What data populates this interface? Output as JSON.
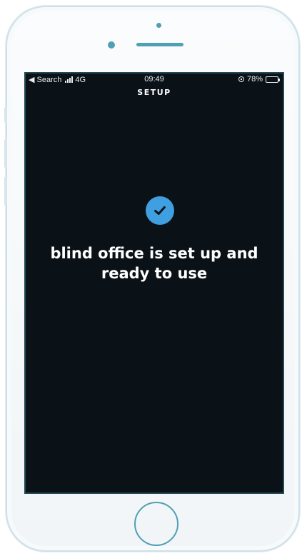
{
  "status_bar": {
    "back_label": "◀ Search",
    "network": "4G",
    "time": "09:49",
    "battery_percent": "78%",
    "battery_level": 0.78
  },
  "header": {
    "title": "SETUP"
  },
  "main": {
    "status_icon": "checkmark-circle-icon",
    "message": "blind office is set up and ready to use"
  },
  "colors": {
    "screen_background": "#0a1117",
    "accent": "#3f9fe0",
    "text": "#ffffff"
  }
}
